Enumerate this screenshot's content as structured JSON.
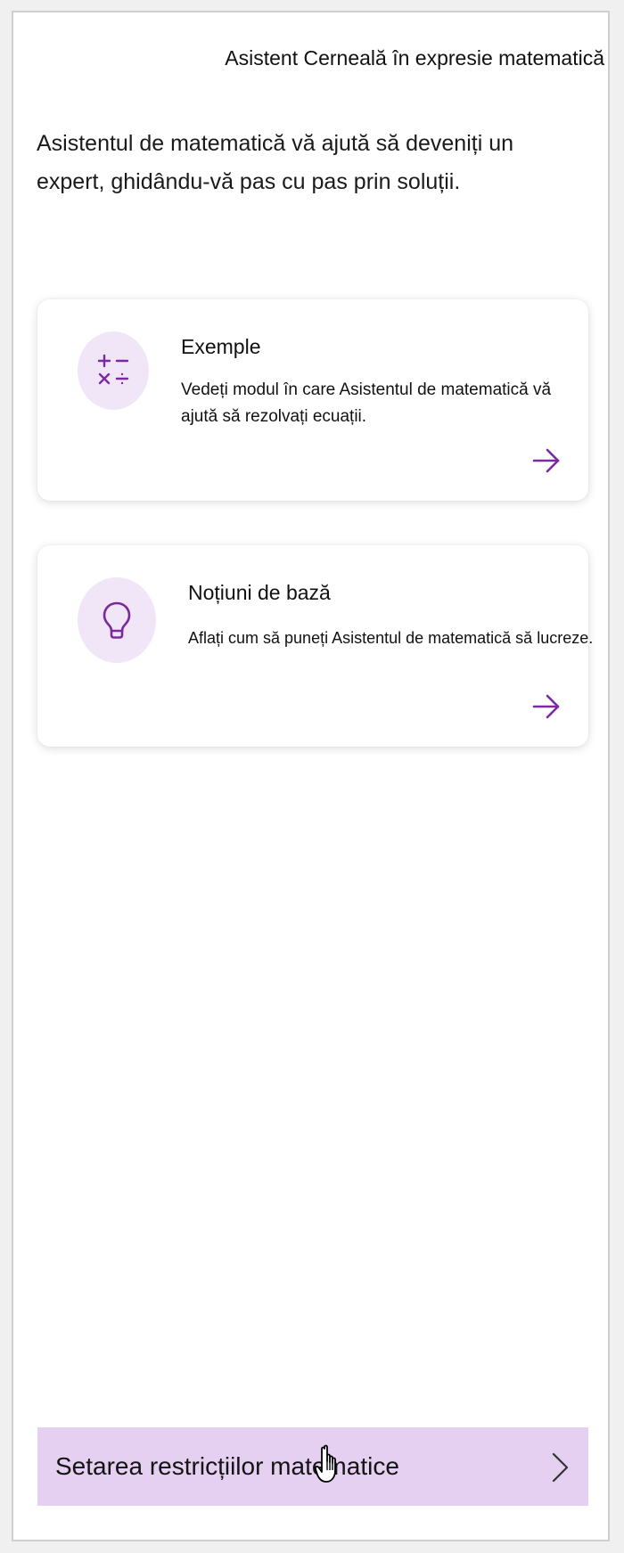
{
  "pane": {
    "header_title": "Asistent Cerneală în expresie matematică",
    "intro_text": "Asistentul de matematică vă ajută să deveniți un expert, ghidându-vă pas cu pas prin soluții."
  },
  "cards": {
    "examples": {
      "title": "Exemple",
      "description": "Vedeți modul în care Asistentul de matematică vă ajută să rezolvați ecuații.",
      "icon": "math-operators-icon",
      "action_icon": "arrow-right-icon"
    },
    "basics": {
      "title": "Noțiuni de bază",
      "description": "Aflați cum să puneți Asistentul de matematică să lucreze.",
      "icon": "lightbulb-icon",
      "action_icon": "arrow-right-icon"
    }
  },
  "restrictions": {
    "label": "Setarea restricțiilor matematice",
    "action_icon": "chevron-right-icon"
  },
  "colors": {
    "accent": "#7b2a9e",
    "icon_circle_bg": "#f1e6f8",
    "restrictions_bg": "#e6d0f1"
  }
}
